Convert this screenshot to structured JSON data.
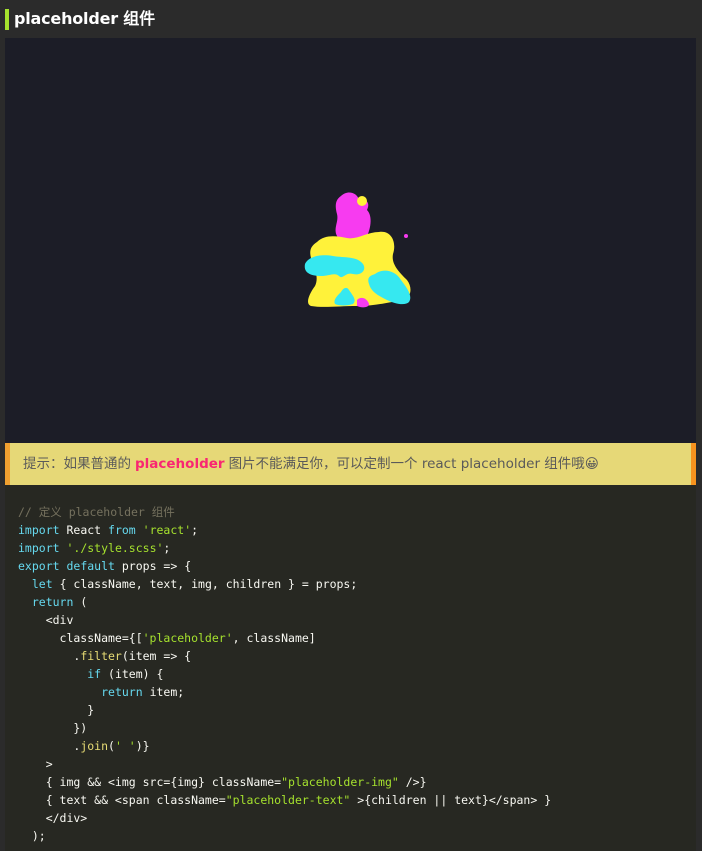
{
  "title": "placeholder 组件",
  "tip": {
    "prefix": "提示：如果普通的",
    "keyword": "placeholder",
    "suffix": "图片不能满足你，可以定制一个 react placeholder 组件哦😀"
  },
  "code": {
    "lines": [
      [
        {
          "t": "// 定义 placeholder 组件",
          "c": "comment"
        }
      ],
      [
        {
          "t": "import",
          "c": "kw"
        },
        {
          "t": " React ",
          "c": "plain"
        },
        {
          "t": "from",
          "c": "kw"
        },
        {
          "t": " ",
          "c": "plain"
        },
        {
          "t": "'react'",
          "c": "str"
        },
        {
          "t": ";",
          "c": "plain"
        }
      ],
      [
        {
          "t": "import",
          "c": "kw"
        },
        {
          "t": " ",
          "c": "plain"
        },
        {
          "t": "'./style.scss'",
          "c": "str"
        },
        {
          "t": ";",
          "c": "plain"
        }
      ],
      [
        {
          "t": "export",
          "c": "kw"
        },
        {
          "t": " ",
          "c": "plain"
        },
        {
          "t": "default",
          "c": "kw"
        },
        {
          "t": " props => {",
          "c": "plain"
        }
      ],
      [
        {
          "t": "  ",
          "c": "plain"
        },
        {
          "t": "let",
          "c": "kw"
        },
        {
          "t": " { className, text, img, children } = props;",
          "c": "plain"
        }
      ],
      [
        {
          "t": "  ",
          "c": "plain"
        },
        {
          "t": "return",
          "c": "kw"
        },
        {
          "t": " (",
          "c": "plain"
        }
      ],
      [
        {
          "t": "    <div",
          "c": "plain"
        }
      ],
      [
        {
          "t": "      className={[",
          "c": "plain"
        },
        {
          "t": "'placeholder'",
          "c": "str"
        },
        {
          "t": ", className]",
          "c": "plain"
        }
      ],
      [
        {
          "t": "        .",
          "c": "plain"
        },
        {
          "t": "filter",
          "c": "fn"
        },
        {
          "t": "(item => {",
          "c": "plain"
        }
      ],
      [
        {
          "t": "          ",
          "c": "plain"
        },
        {
          "t": "if",
          "c": "kw"
        },
        {
          "t": " (item) {",
          "c": "plain"
        }
      ],
      [
        {
          "t": "            ",
          "c": "plain"
        },
        {
          "t": "return",
          "c": "kw"
        },
        {
          "t": " item;",
          "c": "plain"
        }
      ],
      [
        {
          "t": "          }",
          "c": "plain"
        }
      ],
      [
        {
          "t": "        })",
          "c": "plain"
        }
      ],
      [
        {
          "t": "        .",
          "c": "plain"
        },
        {
          "t": "join",
          "c": "fn"
        },
        {
          "t": "(",
          "c": "plain"
        },
        {
          "t": "' '",
          "c": "str"
        },
        {
          "t": ")}",
          "c": "plain"
        }
      ],
      [
        {
          "t": "    >",
          "c": "plain"
        }
      ],
      [
        {
          "t": "    { img && <img src={img} className=",
          "c": "plain"
        },
        {
          "t": "\"placeholder-img\"",
          "c": "str"
        },
        {
          "t": " />}",
          "c": "plain"
        }
      ],
      [
        {
          "t": "    { text && <span className=",
          "c": "plain"
        },
        {
          "t": "\"placeholder-text\"",
          "c": "str"
        },
        {
          "t": " >{children || text}</span> }",
          "c": "plain"
        }
      ],
      [
        {
          "t": "    </div>",
          "c": "plain"
        }
      ],
      [
        {
          "t": "  );",
          "c": "plain"
        }
      ]
    ]
  },
  "colors": {
    "accent": "#a6e22e",
    "tip_background": "#e6d877",
    "tip_keyword": "#f92672",
    "code_background": "#272822",
    "image_background": "#1c1d27",
    "blob_magenta": "#f73bf0",
    "blob_yellow": "#fff23a",
    "blob_cyan": "#36e8f0"
  }
}
